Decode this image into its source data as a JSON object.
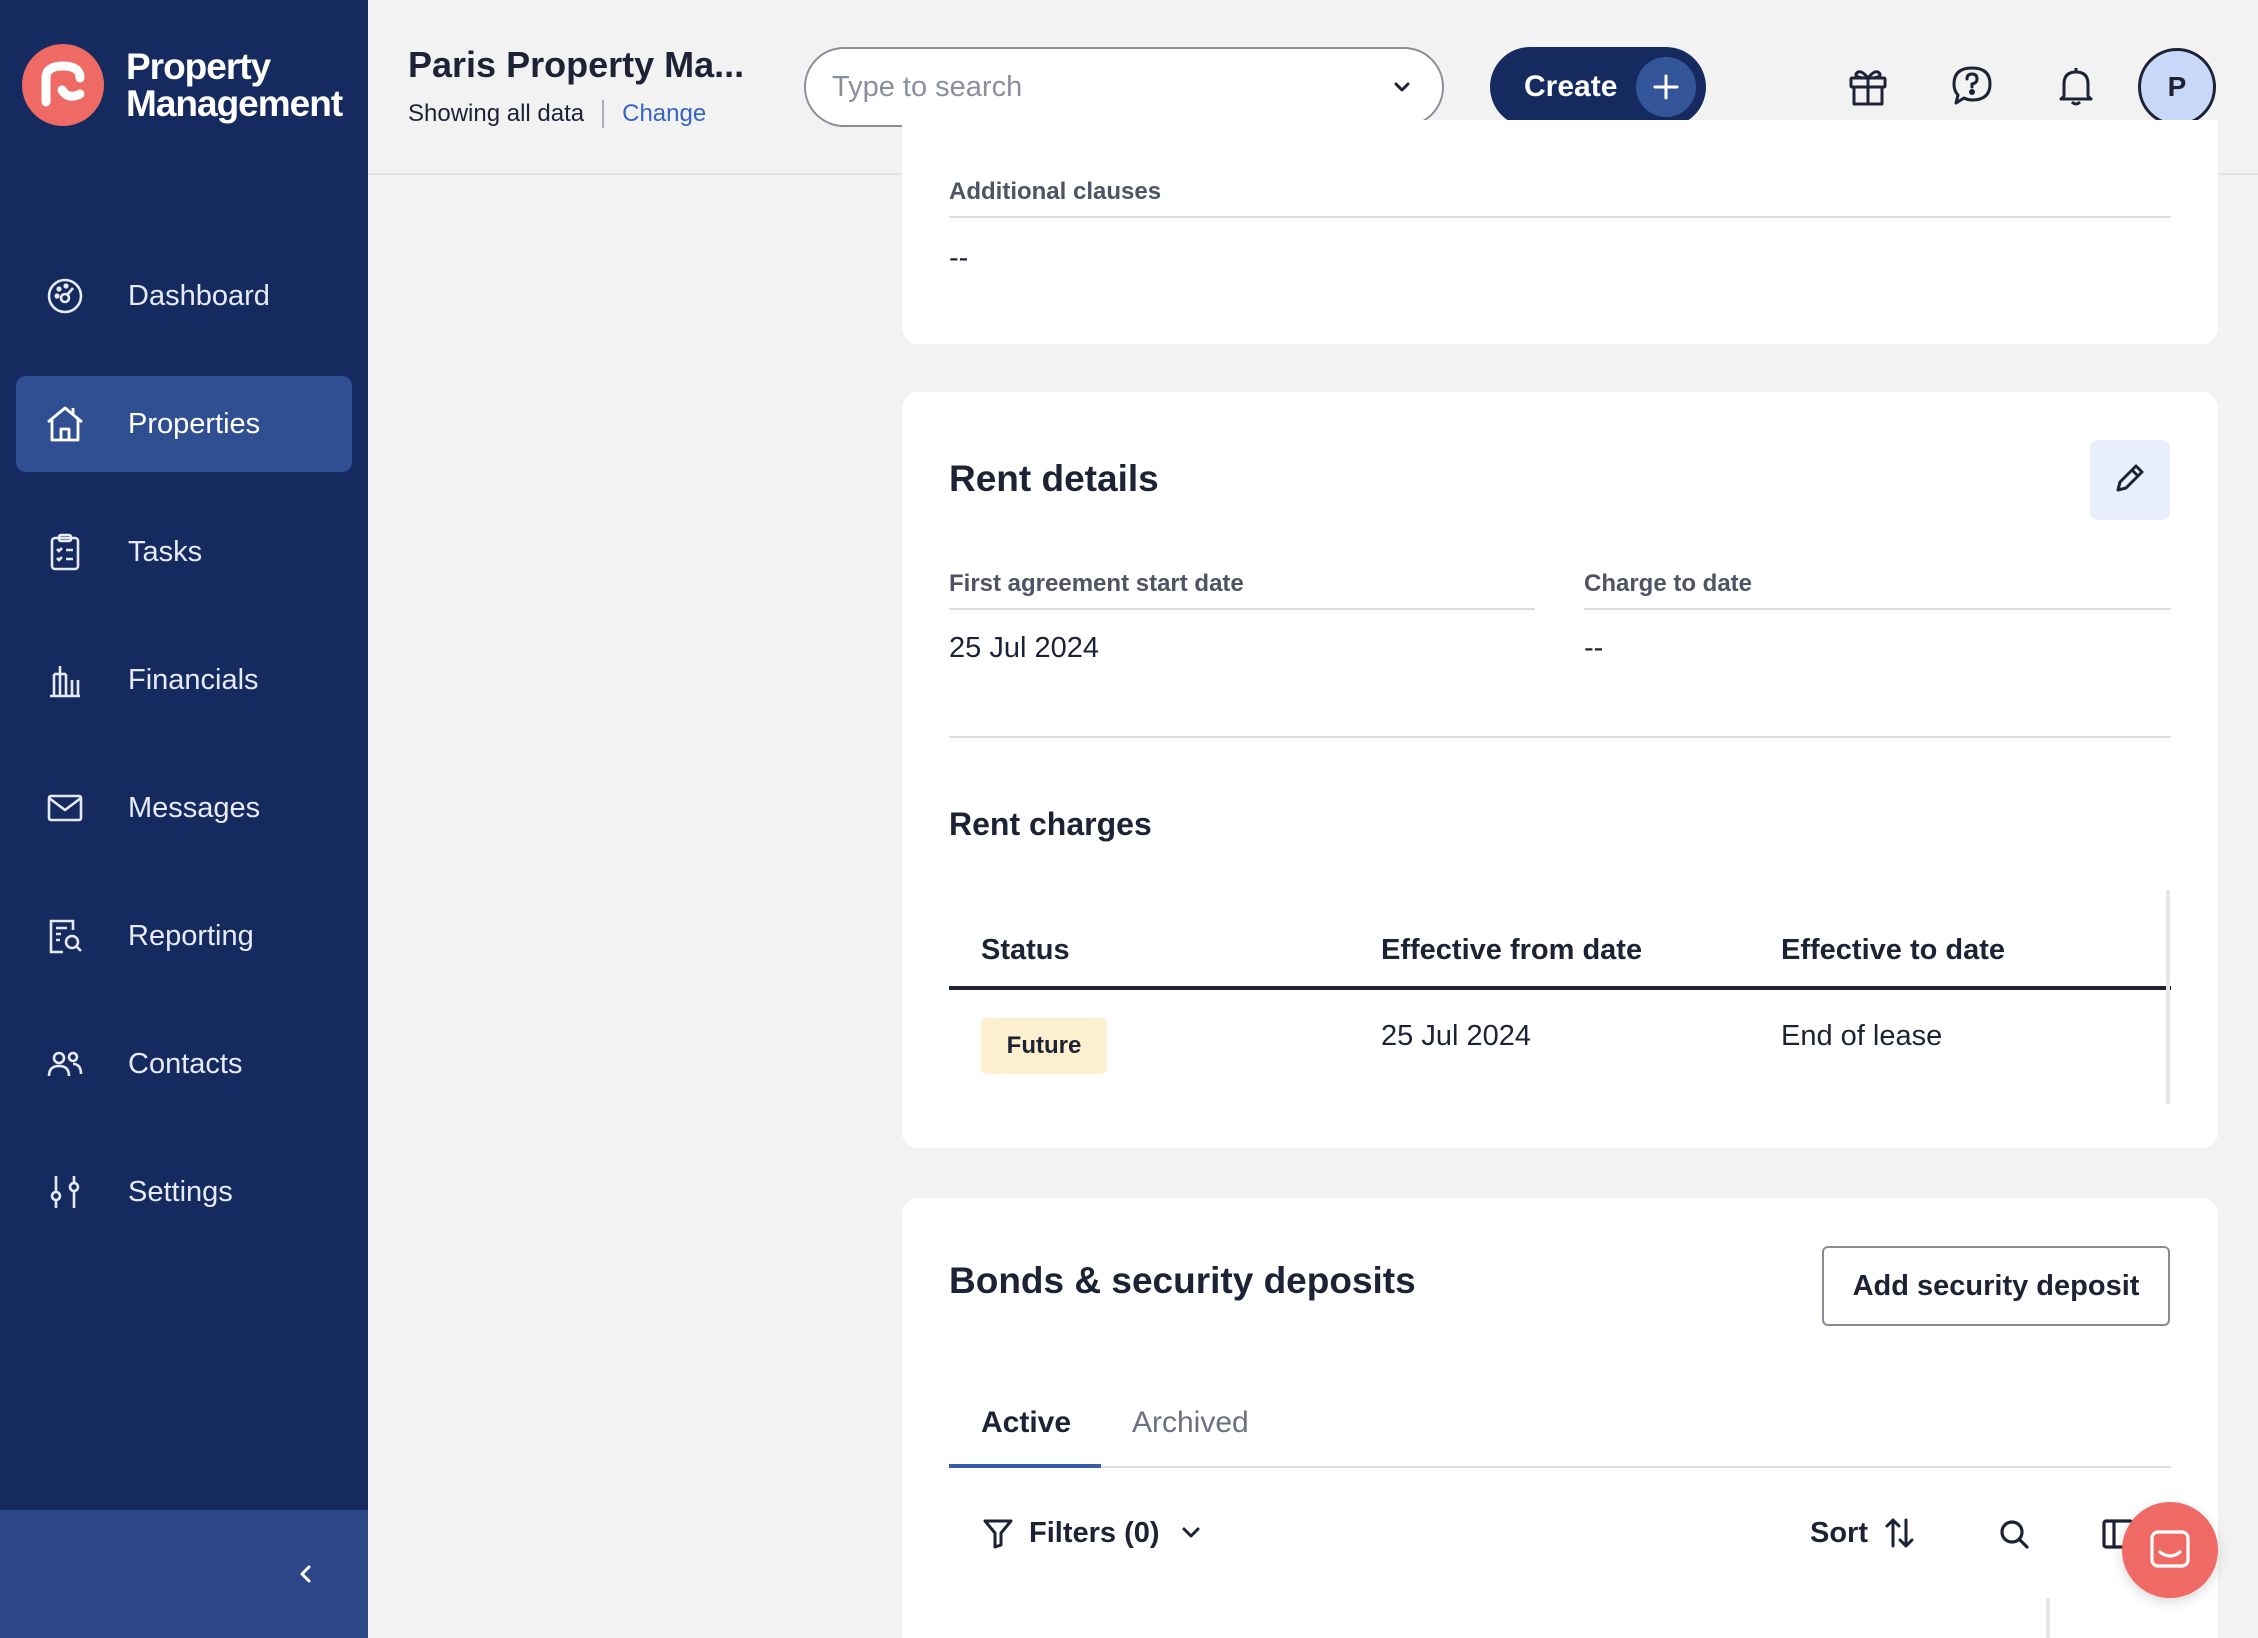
{
  "brand": {
    "line1": "Property",
    "line2": "Management"
  },
  "sidebar": {
    "items": [
      {
        "label": "Dashboard",
        "icon": "dashboard-icon"
      },
      {
        "label": "Properties",
        "icon": "home-icon",
        "active": true
      },
      {
        "label": "Tasks",
        "icon": "clipboard-icon"
      },
      {
        "label": "Financials",
        "icon": "bank-icon"
      },
      {
        "label": "Messages",
        "icon": "mail-icon"
      },
      {
        "label": "Reporting",
        "icon": "report-search-icon"
      },
      {
        "label": "Contacts",
        "icon": "contacts-icon"
      },
      {
        "label": "Settings",
        "icon": "sliders-icon"
      }
    ],
    "collapse_icon": "chevron-left-icon"
  },
  "header": {
    "account_title": "Paris Property Ma...",
    "account_sub": "Showing all data",
    "change_link": "Change",
    "search_placeholder": "Type to search",
    "create_label": "Create",
    "avatar_initial": "P",
    "icons": [
      "gift-icon",
      "help-icon",
      "bell-icon"
    ]
  },
  "clauses_card": {
    "label": "Additional clauses",
    "value": "--"
  },
  "rent_details": {
    "title": "Rent details",
    "fields": [
      {
        "label": "First agreement start date",
        "value": "25 Jul 2024"
      },
      {
        "label": "Charge to date",
        "value": "--"
      }
    ],
    "charges": {
      "title": "Rent charges",
      "columns": [
        "Status",
        "Effective from date",
        "Effective to date"
      ],
      "rows": [
        {
          "status": "Future",
          "from": "25 Jul 2024",
          "to": "End of lease"
        }
      ]
    }
  },
  "bonds": {
    "title": "Bonds & security deposits",
    "add_button": "Add security deposit",
    "tabs": [
      "Active",
      "Archived"
    ],
    "filters_label": "Filters (0)",
    "sort_label": "Sort"
  },
  "colors": {
    "sidebar": "#152a5e",
    "sidebar_active": "#304f92",
    "accent": "#ef6a64",
    "link": "#3564c4",
    "badge_future": "#fdf0cf"
  }
}
